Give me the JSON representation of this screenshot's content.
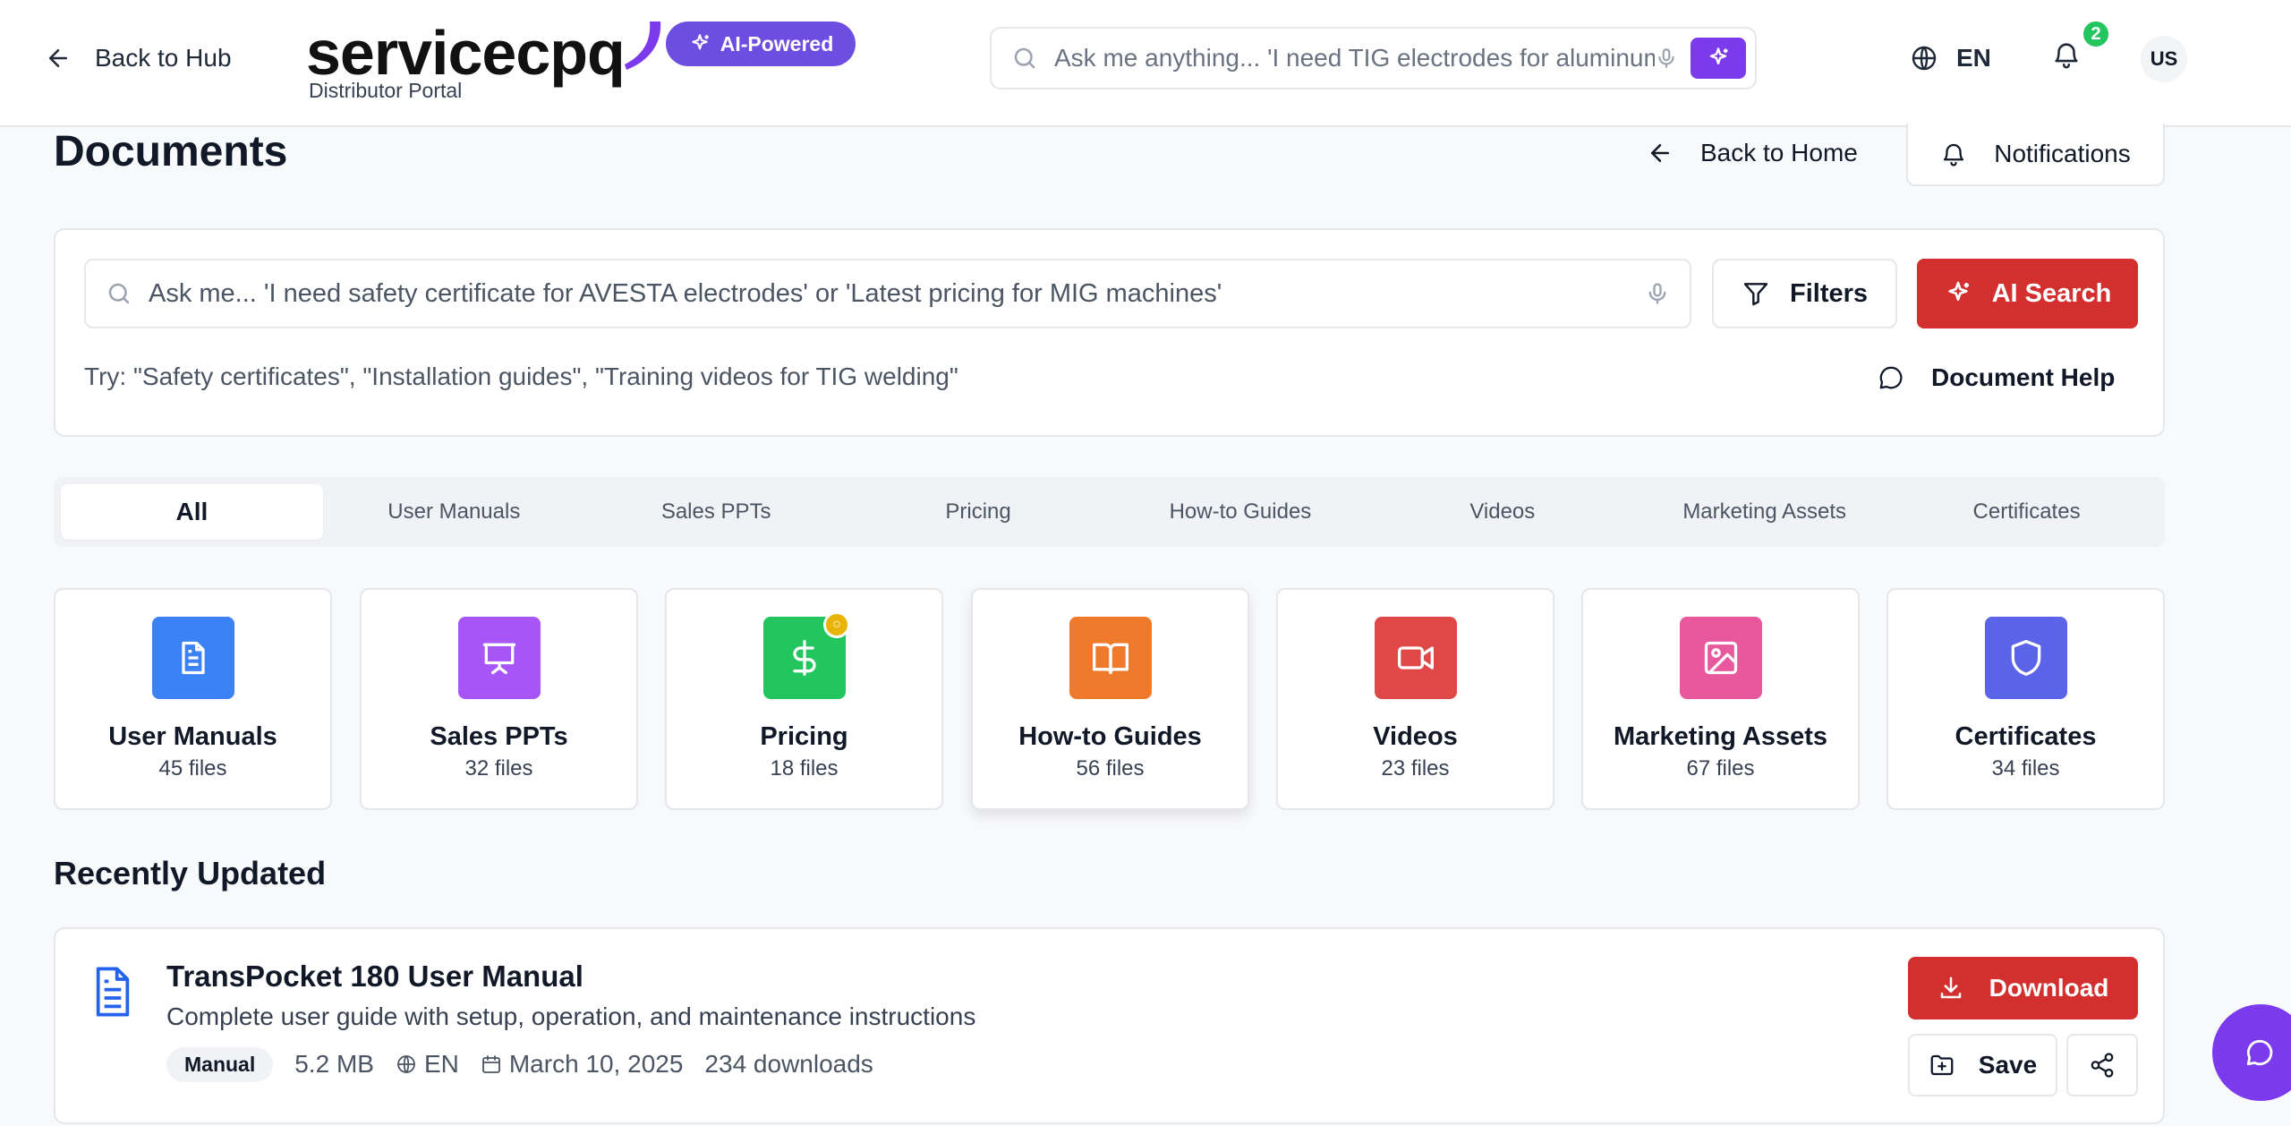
{
  "header": {
    "back_label": "Back to Hub",
    "logo_text": "servicecpq",
    "portal_subtitle": "Distributor Portal",
    "ai_badge": "AI-Powered",
    "search_placeholder": "Ask me anything... 'I need TIG electrodes for aluminum'",
    "language": "EN",
    "notification_count": "2",
    "avatar_initials": "US"
  },
  "page": {
    "title": "Documents",
    "back_home_label": "Back to Home",
    "notifications_label": "Notifications"
  },
  "search": {
    "placeholder": "Ask me... 'I need safety certificate for AVESTA electrodes' or 'Latest pricing for MIG machines'",
    "filters_label": "Filters",
    "ai_search_label": "AI Search",
    "hint": "Try: \"Safety certificates\", \"Installation guides\", \"Training videos for TIG welding\"",
    "help_label": "Document Help"
  },
  "tabs": [
    "All",
    "User Manuals",
    "Sales PPTs",
    "Pricing",
    "How-to Guides",
    "Videos",
    "Marketing Assets",
    "Certificates"
  ],
  "active_tab": "All",
  "categories": [
    {
      "name": "User Manuals",
      "count": "45 files",
      "icon": "document-icon",
      "color": "#3b82f6"
    },
    {
      "name": "Sales PPTs",
      "count": "32 files",
      "icon": "presentation-icon",
      "color": "#a855f7"
    },
    {
      "name": "Pricing",
      "count": "18 files",
      "icon": "dollar-icon",
      "color": "#22c55e"
    },
    {
      "name": "How-to Guides",
      "count": "56 files",
      "icon": "book-open-icon",
      "color": "#f07a2b"
    },
    {
      "name": "Videos",
      "count": "23 files",
      "icon": "video-icon",
      "color": "#e04848"
    },
    {
      "name": "Marketing Assets",
      "count": "67 files",
      "icon": "image-icon",
      "color": "#e8589c"
    },
    {
      "name": "Certificates",
      "count": "34 files",
      "icon": "shield-icon",
      "color": "#5b64e8"
    }
  ],
  "recent": {
    "section_title": "Recently Updated",
    "items": [
      {
        "title": "TransPocket 180 User Manual",
        "description": "Complete user guide with setup, operation, and maintenance instructions",
        "tag": "Manual",
        "size": "5.2 MB",
        "language": "EN",
        "date": "March 10, 2025",
        "downloads": "234 downloads",
        "download_label": "Download",
        "save_label": "Save"
      }
    ]
  },
  "colors": {
    "brand_purple": "#6d4ee0",
    "accent_red": "#d32f2f",
    "badge_green": "#22c55e"
  }
}
